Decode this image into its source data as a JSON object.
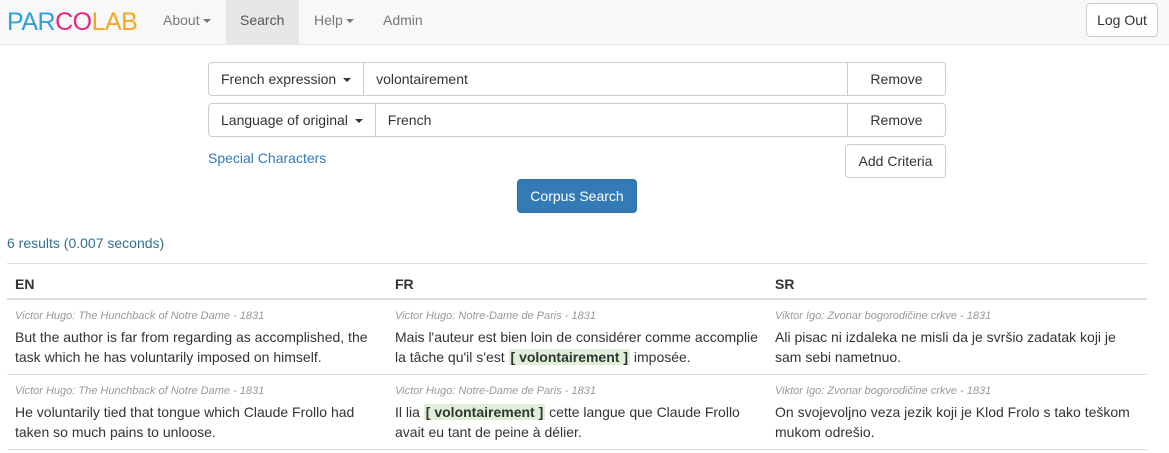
{
  "navbar": {
    "brand": [
      "PAR",
      "CO",
      "LAB"
    ],
    "brand_colors": [
      "#2f9fd9",
      "#e6277b",
      "#f5a623"
    ],
    "items": [
      {
        "label": "About",
        "dropdown": true
      },
      {
        "label": "Search",
        "dropdown": false,
        "active": true
      },
      {
        "label": "Help",
        "dropdown": true
      },
      {
        "label": "Admin",
        "dropdown": false
      }
    ],
    "logout_label": "Log Out"
  },
  "criteria": [
    {
      "field": "French expression",
      "value": "volontairement",
      "remove_label": "Remove"
    },
    {
      "field": "Language of original",
      "value": "French",
      "remove_label": "Remove"
    }
  ],
  "special_characters_label": "Special Characters",
  "add_criteria_label": "Add Criteria",
  "corpus_search_label": "Corpus Search",
  "results_summary": "6 results (0.007 seconds)",
  "table": {
    "columns": [
      "EN",
      "FR",
      "SR"
    ],
    "rows": [
      {
        "en": {
          "meta": "Victor Hugo: The Hunchback of Notre Dame - 1831",
          "text": "But the author is far from regarding as accomplished, the task which he has voluntarily imposed on himself."
        },
        "fr": {
          "meta": "Victor Hugo: Notre-Dame de Paris - 1831",
          "before": "Mais l'auteur est bien loin de considérer comme accomplie la tâche qu'il s'est ",
          "highlight": "[ volontairement ]",
          "after": " imposée."
        },
        "sr": {
          "meta": "Viktor Igo: Zvonar bogorodičine crkve - 1831",
          "text": "Ali pisac ni izdaleka ne misli da je svršio zadatak koji je sam sebi nametnuo."
        }
      },
      {
        "en": {
          "meta": "Victor Hugo: The Hunchback of Notre Dame - 1831",
          "text": "He voluntarily tied that tongue which Claude Frollo had taken so much pains to unloose."
        },
        "fr": {
          "meta": "Victor Hugo: Notre-Dame de Paris - 1831",
          "before": "Il lia ",
          "highlight": "[ volontairement ]",
          "after": " cette langue que Claude Frollo avait eu tant de peine à délier."
        },
        "sr": {
          "meta": "Viktor Igo: Zvonar bogorodičine crkve - 1831",
          "text": "On svojevoljno veza jezik koji je Klod Frolo s tako teškom mukom odrešio."
        }
      }
    ]
  }
}
